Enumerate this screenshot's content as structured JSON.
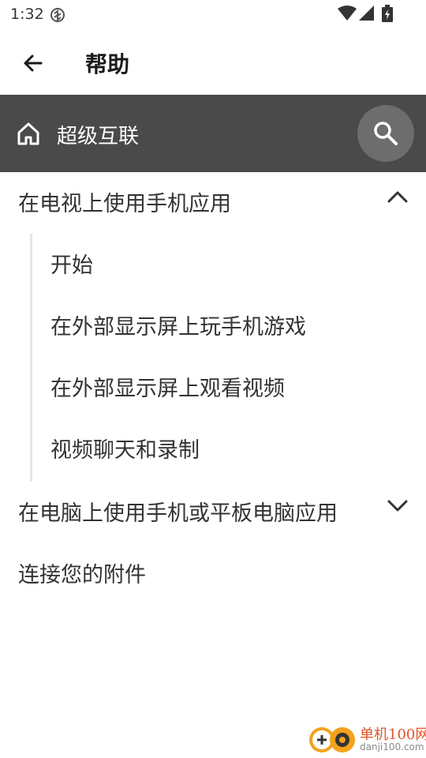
{
  "status": {
    "time": "1:32"
  },
  "header": {
    "title": "帮助"
  },
  "section_bar": {
    "title": "超级互联"
  },
  "menu": {
    "group1": {
      "label": "在电视上使用手机应用",
      "expanded": true,
      "items": [
        "开始",
        "在外部显示屏上玩手机游戏",
        "在外部显示屏上观看视频",
        "视频聊天和录制"
      ]
    },
    "group2": {
      "label": "在电脑上使用手机或平板电脑应用",
      "expanded": false
    },
    "item3": {
      "label": "连接您的附件"
    }
  },
  "watermark": {
    "line1": "单机100网",
    "line2": "danji100.com"
  },
  "colors": {
    "section_bar": "#4a4a4a",
    "search_circle": "#6d6d6d",
    "text": "#333333",
    "watermark_accent": "#e0532a"
  }
}
